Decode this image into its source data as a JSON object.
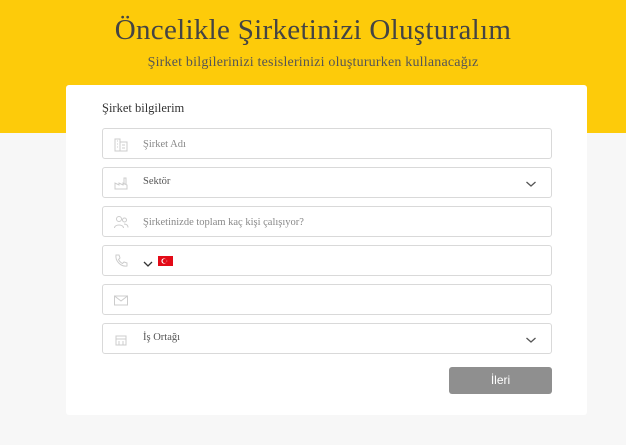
{
  "header": {
    "title": "Öncelikle Şirketinizi Oluşturalım",
    "subtitle": "Şirket bilgilerinizi tesislerinizi oluştururken kullanacağız"
  },
  "form": {
    "section_title": "Şirket bilgilerim",
    "company_name_placeholder": "Şirket Adı",
    "sector_value": "Sektör",
    "employee_count_placeholder": "Şirketinizde toplam kaç kişi çalışıyor?",
    "phone_value": "",
    "email_value": "",
    "partner_value": "İş Ortağı",
    "next_button_label": "İleri"
  },
  "icons": {
    "company": "building-icon",
    "sector": "industry-icon",
    "employees": "people-icon",
    "phone": "phone-icon",
    "email": "envelope-icon",
    "partner": "handshake-icon",
    "dropdown": "chevron-down-icon",
    "country_flag": "turkey-flag-icon"
  },
  "colors": {
    "header_background": "#fdcb0a",
    "button_background": "#8f8f8f",
    "page_background": "#f7f7f7"
  }
}
